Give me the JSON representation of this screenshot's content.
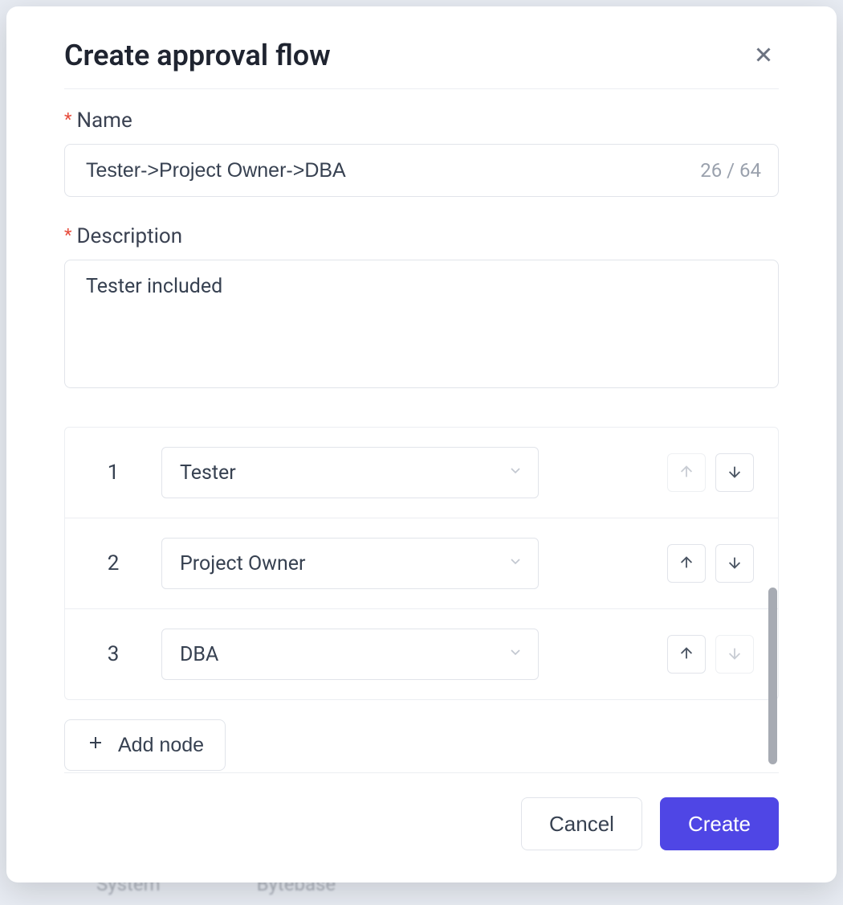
{
  "modal": {
    "title": "Create approval flow",
    "name_label": "Name",
    "name_value": "Tester->Project Owner->DBA",
    "name_count": "26 / 64",
    "desc_label": "Description",
    "desc_value": "Tester included",
    "add_node_label": "Add node",
    "steps": [
      {
        "index": "1",
        "role": "Tester",
        "up_enabled": false,
        "down_enabled": true
      },
      {
        "index": "2",
        "role": "Project Owner",
        "up_enabled": true,
        "down_enabled": true
      },
      {
        "index": "3",
        "role": "DBA",
        "up_enabled": true,
        "down_enabled": false
      }
    ],
    "cancel_label": "Cancel",
    "create_label": "Create"
  },
  "backdrop": {
    "col1": "System",
    "col2": "Bytebase"
  }
}
